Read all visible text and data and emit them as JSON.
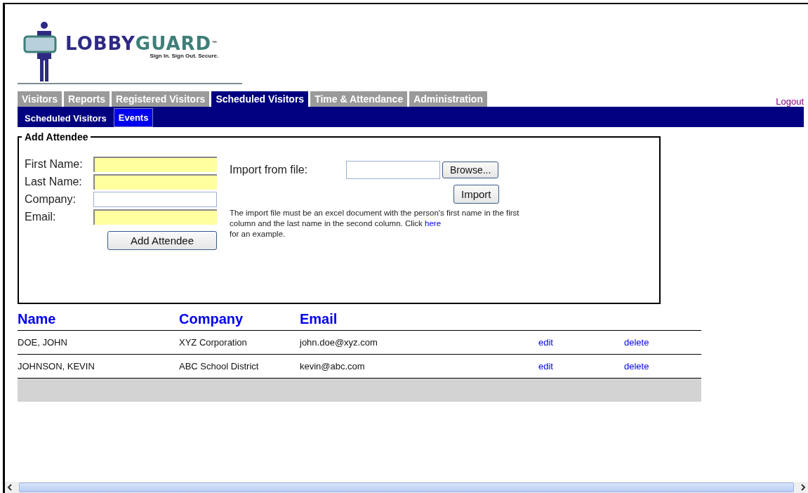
{
  "logo": {
    "name_parts": [
      "LOBBY",
      "GUARD"
    ],
    "trademark": "™",
    "tagline": "Sign In. Sign Out. Secure."
  },
  "tabs": [
    {
      "label": "Visitors",
      "selected": false
    },
    {
      "label": "Reports",
      "selected": false
    },
    {
      "label": "Registered Visitors",
      "selected": false
    },
    {
      "label": "Scheduled Visitors",
      "selected": true
    },
    {
      "label": "Time & Attendance",
      "selected": false
    },
    {
      "label": "Administration",
      "selected": false
    }
  ],
  "logout": "Logout",
  "subtabs": [
    {
      "label": "Scheduled Visitors",
      "selected": false
    },
    {
      "label": "Events",
      "selected": true
    }
  ],
  "form": {
    "legend": "Add Attendee",
    "fields": [
      {
        "label": "First Name:",
        "required": true
      },
      {
        "label": "Last Name:",
        "required": true
      },
      {
        "label": "Company:",
        "required": false
      },
      {
        "label": "Email:",
        "required": true
      }
    ],
    "submit": "Add Attendee",
    "import_label": "Import from file:",
    "browse": "Browse...",
    "import_button": "Import",
    "help_before": "The import file must be an excel document with the person's first name in the first column and the last name in the second column. Click ",
    "help_link": "here",
    "help_after": "for an example."
  },
  "table": {
    "columns": [
      "Name",
      "Company",
      "Email"
    ],
    "rows": [
      {
        "name": "DOE, JOHN",
        "company": "XYZ Corporation",
        "email": "john.doe@xyz.com",
        "edit": "edit",
        "delete": "delete"
      },
      {
        "name": "JOHNSON, KEVIN",
        "company": "ABC School District",
        "email": "kevin@abc.com",
        "edit": "edit",
        "delete": "delete"
      }
    ]
  }
}
